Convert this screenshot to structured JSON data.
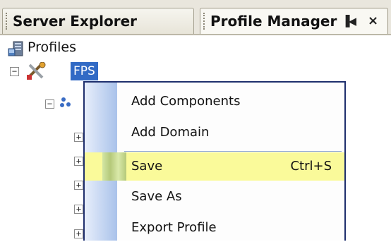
{
  "tabs": {
    "server_explorer": "Server Explorer",
    "profile_manager": "Profile Manager",
    "pin_glyph": "▐◀",
    "close_glyph": "×"
  },
  "tree": {
    "root_label": "Profiles",
    "profile_label": "FPS"
  },
  "menu": {
    "items": [
      {
        "label": "Add Components",
        "shortcut": ""
      },
      {
        "label": "Add Domain",
        "shortcut": ""
      },
      {
        "label": "Save",
        "shortcut": "Ctrl+S"
      },
      {
        "label": "Save As",
        "shortcut": ""
      },
      {
        "label": "Export Profile",
        "shortcut": ""
      }
    ],
    "highlighted_index": 2
  },
  "colors": {
    "selection": "#316ac5",
    "menu_border": "#1f2f6d",
    "highlight": "#fafa9a"
  }
}
